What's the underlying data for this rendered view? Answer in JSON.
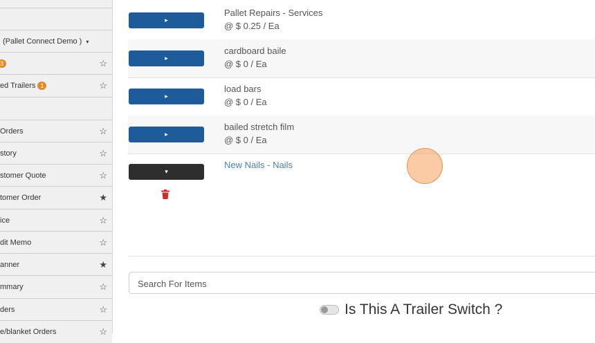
{
  "sidebar": {
    "rows": [
      {
        "label": "",
        "star": "",
        "badge": ""
      },
      {
        "label": "(Pallet Connect Demo )",
        "star": "",
        "badge": "",
        "caret": "▾"
      },
      {
        "label": "",
        "star": "☆",
        "badge": "3"
      },
      {
        "label": "ed Trailers",
        "star": "☆",
        "badge": "1"
      },
      {
        "label": "",
        "star": "",
        "badge": "",
        "caret": "▾"
      },
      {
        "label": "Orders",
        "star": "☆",
        "badge": ""
      },
      {
        "label": "story",
        "star": "☆",
        "badge": ""
      },
      {
        "label": "stomer Quote",
        "star": "☆",
        "badge": ""
      },
      {
        "label": "tomer Order",
        "star": "★",
        "badge": ""
      },
      {
        "label": "ice",
        "star": "☆",
        "badge": ""
      },
      {
        "label": "dit Memo",
        "star": "☆",
        "badge": ""
      },
      {
        "label": "anner",
        "star": "★",
        "badge": ""
      },
      {
        "label": "mmary",
        "star": "☆",
        "badge": ""
      },
      {
        "label": "ders",
        "star": "☆",
        "badge": ""
      },
      {
        "label": "e/blanket Orders",
        "star": "☆",
        "badge": ""
      }
    ]
  },
  "items": [
    {
      "name": "Pallet Repairs - Services",
      "price": "@ $ 0.25 / Ea",
      "button": "▸"
    },
    {
      "name": "cardboard baile",
      "price": "@ $ 0 / Ea",
      "button": "▸"
    },
    {
      "name": "load bars",
      "price": "@ $ 0 / Ea",
      "button": "▸"
    },
    {
      "name": "bailed stretch film",
      "price": "@ $ 0 / Ea",
      "button": "▸"
    }
  ],
  "new_item": {
    "name": "New Nails - Nails",
    "button": "▾"
  },
  "search": {
    "placeholder": "Search For Items",
    "value": ""
  },
  "trailer_switch": {
    "label": "Is This A Trailer Switch ?",
    "on": false
  },
  "colors": {
    "button_blue": "#1e5b9a",
    "button_dark": "#2e2e2e",
    "badge_orange": "#e08b2a",
    "link_blue": "#4a80b5",
    "trash_red": "#c9302c"
  },
  "icons": {
    "trash": "trash-icon",
    "star_empty": "star-outline-icon",
    "star_full": "star-filled-icon"
  }
}
